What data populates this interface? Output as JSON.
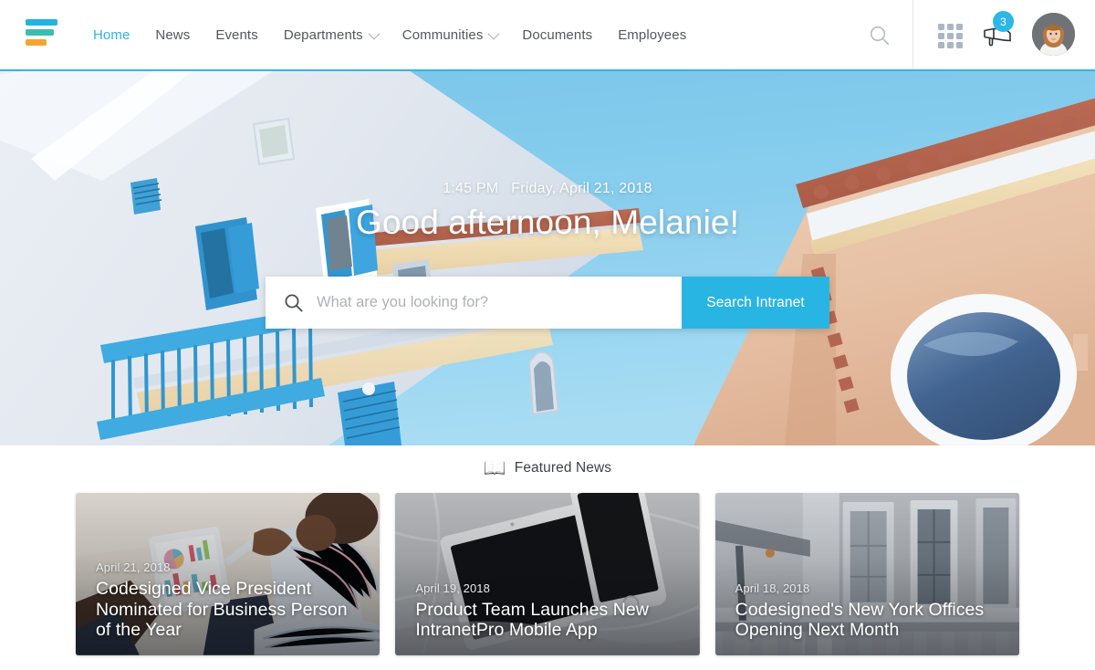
{
  "brand": {
    "logo_name": "codesigned-logo",
    "accent_color": "#29b5e3",
    "logo_colors": [
      "#24b3e0",
      "#3dbdb0",
      "#f2a535",
      "#e8196a"
    ]
  },
  "header": {
    "nav": [
      {
        "label": "Home",
        "active": true,
        "has_caret": false
      },
      {
        "label": "News",
        "active": false,
        "has_caret": false
      },
      {
        "label": "Events",
        "active": false,
        "has_caret": false
      },
      {
        "label": "Departments",
        "active": false,
        "has_caret": true
      },
      {
        "label": "Communities",
        "active": false,
        "has_caret": true
      },
      {
        "label": "Documents",
        "active": false,
        "has_caret": false
      },
      {
        "label": "Employees",
        "active": false,
        "has_caret": false
      }
    ],
    "search_icon": "search-icon",
    "app_launcher_icon": "grid-apps-icon",
    "announcements_icon": "megaphone-icon",
    "notification_count": "3",
    "avatar_label": "user-avatar-melanie"
  },
  "hero": {
    "time": "1:45 PM",
    "date": "Friday, April 21, 2018",
    "greeting": "Good afternoon, Melanie!",
    "search": {
      "placeholder": "What are you looking for?",
      "value": "",
      "button_label": "Search Intranet",
      "icon": "search-icon"
    }
  },
  "featured": {
    "icon": "📖",
    "icon_name": "open-book-icon",
    "title": "Featured News",
    "cards": [
      {
        "date": "April 21, 2018",
        "headline": "Codesigned Vice President Nominated for Business Person of the Year",
        "image_name": "man-with-tablet-charts-photo"
      },
      {
        "date": "April 19, 2018",
        "headline": "Product Team Launches New IntranetPro Mobile App",
        "image_name": "tablet-and-phone-on-marble-photo"
      },
      {
        "date": "April 18, 2018",
        "headline": "Codesigned's New York Offices Opening Next Month",
        "image_name": "new-york-building-facade-photo"
      }
    ]
  }
}
